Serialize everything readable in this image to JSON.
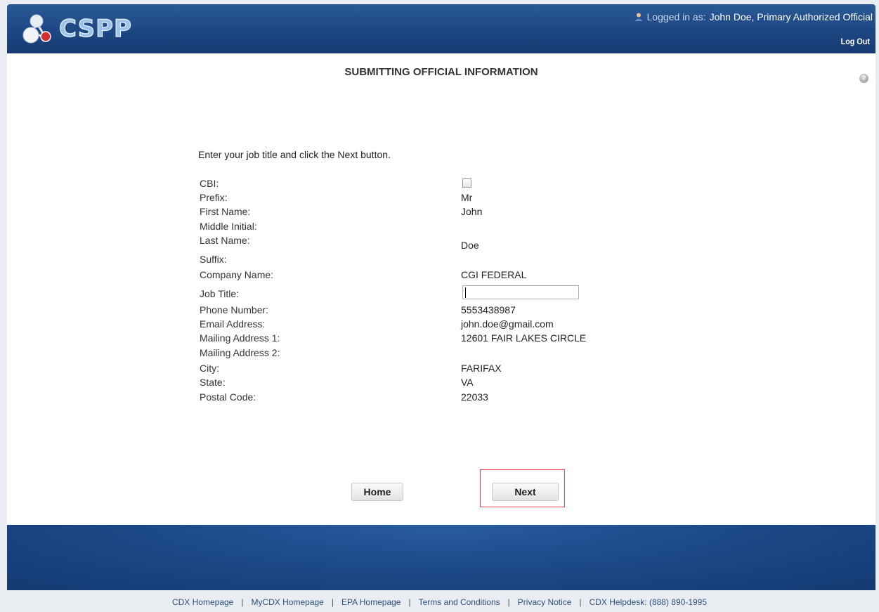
{
  "header": {
    "logo_text": "CSPP",
    "logged_in_prefix": "Logged in as:",
    "user_name": "John Doe, Primary Authorized Official",
    "logout_label": "Log Out"
  },
  "page": {
    "title": "SUBMITTING OFFICIAL INFORMATION",
    "instruction": "Enter your job title and click the Next button."
  },
  "form": {
    "cbi": {
      "label": "CBI:",
      "checked": false
    },
    "prefix": {
      "label": "Prefix:",
      "value": "Mr"
    },
    "first_name": {
      "label": "First Name:",
      "value": "John"
    },
    "middle_initial": {
      "label": "Middle Initial:",
      "value": ""
    },
    "last_name": {
      "label": "Last Name:",
      "value": "Doe"
    },
    "suffix": {
      "label": "Suffix:",
      "value": ""
    },
    "company_name": {
      "label": "Company Name:",
      "value": "CGI FEDERAL"
    },
    "job_title": {
      "label": "Job Title:",
      "value": ""
    },
    "phone_number": {
      "label": "Phone Number:",
      "value": "5553438987"
    },
    "email_address": {
      "label": "Email Address:",
      "value": "john.doe@gmail.com"
    },
    "mailing_address_1": {
      "label": "Mailing Address 1:",
      "value": "12601 FAIR LAKES CIRCLE"
    },
    "mailing_address_2": {
      "label": "Mailing Address 2:",
      "value": ""
    },
    "city": {
      "label": "City:",
      "value": "FARIFAX"
    },
    "state": {
      "label": "State:",
      "value": "VA"
    },
    "postal_code": {
      "label": "Postal Code:",
      "value": "22033"
    }
  },
  "buttons": {
    "home_label": "Home",
    "next_label": "Next"
  },
  "footer": {
    "cdx_homepage": "CDX Homepage",
    "mycdx_homepage": "MyCDX Homepage",
    "epa_homepage": "EPA Homepage",
    "terms": "Terms and Conditions",
    "privacy": "Privacy Notice",
    "helpdesk": "CDX Helpdesk: (888) 890-1995",
    "separator": "|"
  },
  "colors": {
    "header_blue": "#1d4784",
    "highlight_red": "#e04050",
    "link_blue": "#2a4f7d"
  },
  "icons": {
    "logo": "molecule-logo-icon",
    "user": "user-icon",
    "help": "help-icon"
  }
}
